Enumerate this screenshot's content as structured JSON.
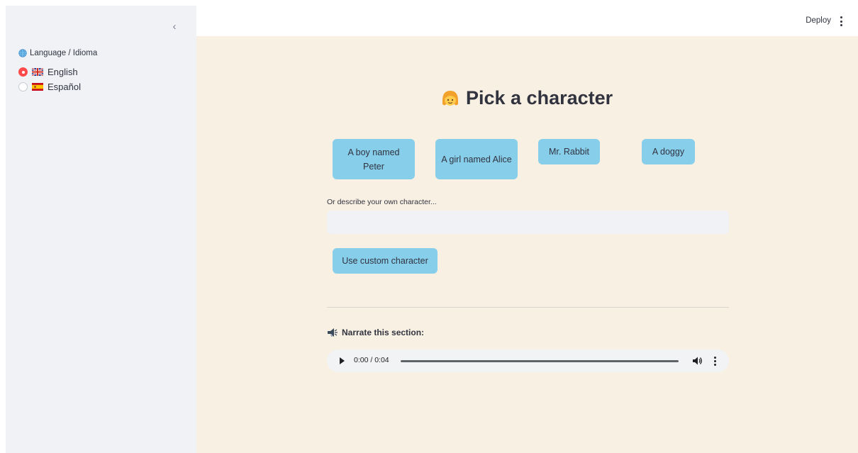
{
  "sidebar": {
    "collapse_glyph": "‹",
    "language_label": "Language / Idioma",
    "language_icon": "globe-icon",
    "options": [
      {
        "label": "English",
        "flag": "uk-flag-icon",
        "selected": true
      },
      {
        "label": "Español",
        "flag": "spain-flag-icon",
        "selected": false
      }
    ]
  },
  "header": {
    "deploy_label": "Deploy",
    "menu_icon": "kebab-menu-icon"
  },
  "main": {
    "title": "Pick a character",
    "title_icon": "girl-face-icon",
    "characters": [
      {
        "label": "A boy named Peter"
      },
      {
        "label": "A girl named Alice"
      },
      {
        "label": "Mr. Rabbit"
      },
      {
        "label": "A doggy"
      }
    ],
    "custom_label": "Or describe your own character...",
    "custom_value": "",
    "custom_button": "Use custom character",
    "narrate_label": "Narrate this section:",
    "narrate_icon": "speaker-icon",
    "audio": {
      "time": "0:00 / 0:04",
      "progress": 0
    }
  },
  "colors": {
    "accent": "#ff4b4b",
    "button": "#87ceeb",
    "main_bg": "#f8f0e3",
    "sidebar_bg": "#f0f2f6"
  }
}
